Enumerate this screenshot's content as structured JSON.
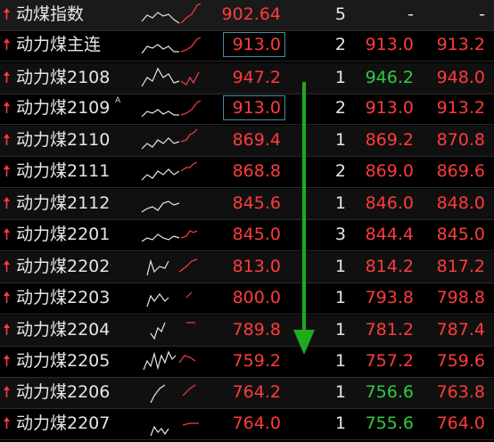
{
  "colors": {
    "up": "#ff3b3b",
    "down": "#2ecc40",
    "neutral": "#e6e6e6",
    "arrow_green": "#1faa1f",
    "box_border": "#4a8ba0"
  },
  "rows": [
    {
      "name": "动煤指数",
      "sup": "",
      "last": "902.64",
      "vol": "5",
      "bid": "-",
      "ask": "-",
      "bid_color": "neutral",
      "ask_color": "neutral",
      "boxed": false
    },
    {
      "name": "动力煤主连",
      "sup": "",
      "last": "913.0",
      "vol": "2",
      "bid": "913.0",
      "ask": "913.2",
      "bid_color": "up",
      "ask_color": "up",
      "boxed": true
    },
    {
      "name": "动力煤2108",
      "sup": "",
      "last": "947.2",
      "vol": "1",
      "bid": "946.2",
      "ask": "948.0",
      "bid_color": "down",
      "ask_color": "up",
      "boxed": false
    },
    {
      "name": "动力煤2109",
      "sup": "A",
      "last": "913.0",
      "vol": "2",
      "bid": "913.0",
      "ask": "913.2",
      "bid_color": "up",
      "ask_color": "up",
      "boxed": true
    },
    {
      "name": "动力煤2110",
      "sup": "",
      "last": "869.4",
      "vol": "1",
      "bid": "869.2",
      "ask": "870.8",
      "bid_color": "up",
      "ask_color": "up",
      "boxed": false
    },
    {
      "name": "动力煤2111",
      "sup": "",
      "last": "868.8",
      "vol": "2",
      "bid": "869.0",
      "ask": "869.6",
      "bid_color": "up",
      "ask_color": "up",
      "boxed": false
    },
    {
      "name": "动力煤2112",
      "sup": "",
      "last": "845.6",
      "vol": "1",
      "bid": "846.0",
      "ask": "848.0",
      "bid_color": "up",
      "ask_color": "up",
      "boxed": false
    },
    {
      "name": "动力煤2201",
      "sup": "",
      "last": "845.0",
      "vol": "3",
      "bid": "844.4",
      "ask": "845.0",
      "bid_color": "up",
      "ask_color": "up",
      "boxed": false
    },
    {
      "name": "动力煤2202",
      "sup": "",
      "last": "813.0",
      "vol": "1",
      "bid": "814.2",
      "ask": "817.2",
      "bid_color": "up",
      "ask_color": "up",
      "boxed": false
    },
    {
      "name": "动力煤2203",
      "sup": "",
      "last": "800.0",
      "vol": "1",
      "bid": "793.8",
      "ask": "798.8",
      "bid_color": "up",
      "ask_color": "up",
      "boxed": false
    },
    {
      "name": "动力煤2204",
      "sup": "",
      "last": "789.8",
      "vol": "1",
      "bid": "781.2",
      "ask": "787.4",
      "bid_color": "up",
      "ask_color": "up",
      "boxed": false
    },
    {
      "name": "动力煤2205",
      "sup": "",
      "last": "759.2",
      "vol": "1",
      "bid": "757.2",
      "ask": "759.6",
      "bid_color": "up",
      "ask_color": "up",
      "boxed": false
    },
    {
      "name": "动力煤2206",
      "sup": "",
      "last": "764.2",
      "vol": "1",
      "bid": "756.6",
      "ask": "763.8",
      "bid_color": "down",
      "ask_color": "up",
      "boxed": false
    },
    {
      "name": "动力煤2207",
      "sup": "",
      "last": "764.0",
      "vol": "1",
      "bid": "755.6",
      "ask": "764.0",
      "bid_color": "down",
      "ask_color": "up",
      "boxed": false
    }
  ],
  "icons": {
    "row_arrow": "up-arrow-icon",
    "sparkline": "intraday-sparkline-icon",
    "annotation": "down-arrow-annotation-icon"
  }
}
